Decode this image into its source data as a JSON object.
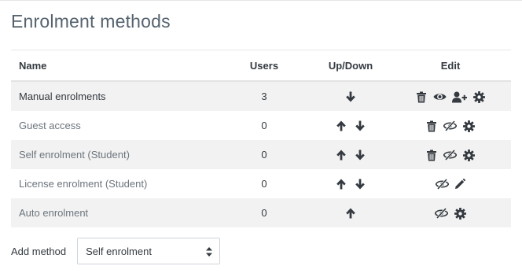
{
  "page": {
    "title": "Enrolment methods"
  },
  "table": {
    "headers": {
      "name": "Name",
      "users": "Users",
      "updown": "Up/Down",
      "edit": "Edit"
    },
    "rows": [
      {
        "name": "Manual enrolments",
        "users": "3",
        "enabled": true,
        "up": false,
        "down": true,
        "edit_icons": [
          "delete-icon",
          "eye-icon",
          "enrol-users-icon",
          "settings-icon"
        ]
      },
      {
        "name": "Guest access",
        "users": "0",
        "enabled": false,
        "up": true,
        "down": true,
        "edit_icons": [
          "delete-icon",
          "eye-slash-icon",
          "settings-icon"
        ]
      },
      {
        "name": "Self enrolment (Student)",
        "users": "0",
        "enabled": false,
        "up": true,
        "down": true,
        "edit_icons": [
          "delete-icon",
          "eye-slash-icon",
          "settings-icon"
        ]
      },
      {
        "name": "License enrolment (Student)",
        "users": "0",
        "enabled": false,
        "up": true,
        "down": true,
        "edit_icons": [
          "eye-slash-icon",
          "pencil-icon"
        ]
      },
      {
        "name": "Auto enrolment",
        "users": "0",
        "enabled": false,
        "up": true,
        "down": false,
        "edit_icons": [
          "eye-slash-icon",
          "settings-icon"
        ]
      }
    ]
  },
  "add_method": {
    "label": "Add method",
    "selected": "Self enrolment"
  },
  "colors": {
    "icon": "#343a40",
    "title": "#56636e",
    "stripe": "#f2f2f2",
    "disabled_text": "#6c757d"
  }
}
